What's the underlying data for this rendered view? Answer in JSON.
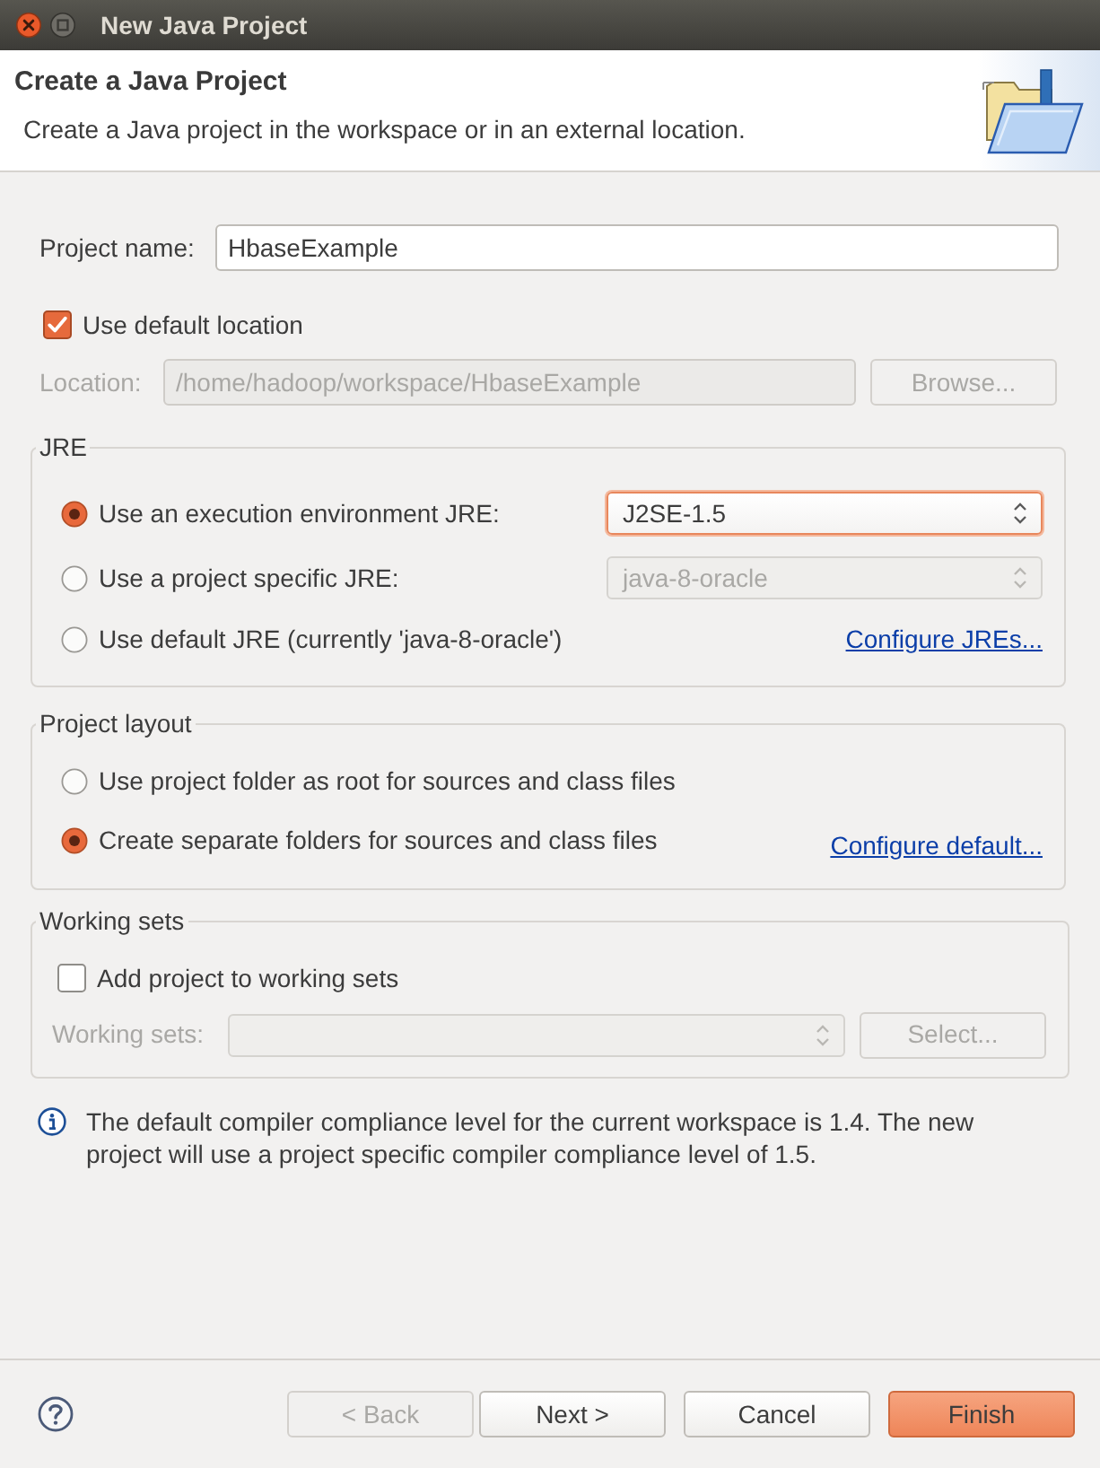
{
  "window": {
    "title": "New Java Project"
  },
  "header": {
    "title": "Create a Java Project",
    "description": "Create a Java project in the workspace or in an external location."
  },
  "project_name": {
    "label": "Project name:",
    "value": "HbaseExample"
  },
  "use_default_location": {
    "label": "Use default location",
    "checked": true
  },
  "location": {
    "label": "Location:",
    "value": "/home/hadoop/workspace/HbaseExample",
    "button": "Browse...",
    "disabled": true
  },
  "jre": {
    "title": "JRE",
    "options": [
      {
        "label": "Use an execution environment JRE:",
        "selected": true,
        "combo": {
          "value": "J2SE-1.5",
          "disabled": false,
          "focused": true
        }
      },
      {
        "label": "Use a project specific JRE:",
        "selected": false,
        "combo": {
          "value": "java-8-oracle",
          "disabled": true,
          "focused": false
        }
      },
      {
        "label": "Use default JRE (currently 'java-8-oracle')",
        "selected": false,
        "link": "Configure JREs..."
      }
    ]
  },
  "project_layout": {
    "title": "Project layout",
    "options": [
      {
        "label": "Use project folder as root for sources and class files",
        "selected": false
      },
      {
        "label": "Create separate folders for sources and class files",
        "selected": true,
        "link": "Configure default..."
      }
    ]
  },
  "working_sets": {
    "title": "Working sets",
    "add": {
      "label": "Add project to working sets",
      "checked": false
    },
    "field_label": "Working sets:",
    "button": "Select...",
    "disabled": true
  },
  "info_message": "The default compiler compliance level for the current workspace is 1.4. The new project will use a project specific compiler compliance level of 1.5.",
  "buttons": [
    {
      "label": "< Back",
      "disabled": true,
      "default": false
    },
    {
      "label": "Next >",
      "disabled": false,
      "default": false
    },
    {
      "label": "Cancel",
      "disabled": false,
      "default": false
    },
    {
      "label": "Finish",
      "disabled": false,
      "default": true
    }
  ]
}
